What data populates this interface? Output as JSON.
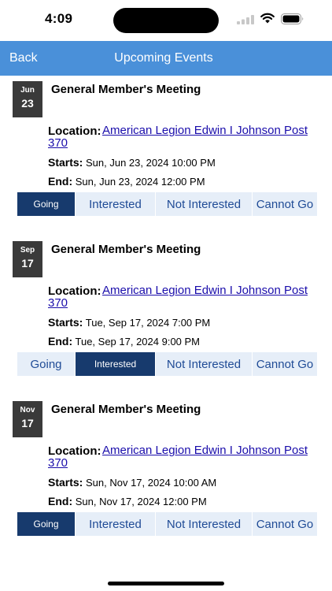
{
  "status_bar": {
    "time": "4:09"
  },
  "nav": {
    "back_label": "Back",
    "title": "Upcoming Events"
  },
  "labels": {
    "location": "Location:",
    "starts": "Starts:",
    "end": "End:"
  },
  "rsvp_options": [
    "Going",
    "Interested",
    "Not Interested",
    "Cannot Go"
  ],
  "events": [
    {
      "month": "Jun",
      "day": "23",
      "title": "General Member's Meeting",
      "location": "American Legion Edwin I Johnson Post 370",
      "starts": "Sun, Jun 23, 2024 10:00 PM",
      "end": "Sun, Jun 23, 2024 12:00 PM",
      "selected": "Going"
    },
    {
      "month": "Sep",
      "day": "17",
      "title": "General Member's Meeting",
      "location": "American Legion Edwin I Johnson Post 370",
      "starts": "Tue, Sep 17, 2024 7:00 PM",
      "end": "Tue, Sep 17, 2024 9:00 PM",
      "selected": "Interested"
    },
    {
      "month": "Nov",
      "day": "17",
      "title": "General Member's Meeting",
      "location": "American Legion Edwin I Johnson Post 370",
      "starts": "Sun, Nov 17, 2024 10:00 AM",
      "end": "Sun, Nov 17, 2024 12:00 PM",
      "selected": "Going"
    }
  ]
}
